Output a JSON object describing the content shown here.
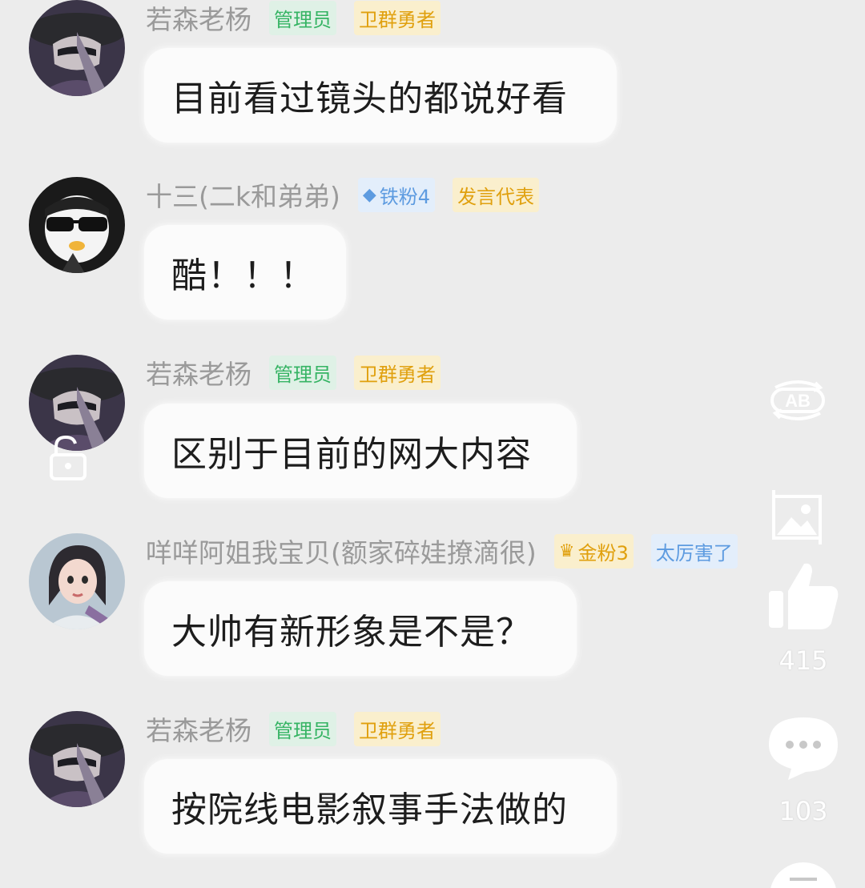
{
  "messages": [
    {
      "name": "若森老杨",
      "badges": [
        {
          "label": "管理员"
        },
        {
          "label": "卫群勇者"
        }
      ],
      "text": "目前看过镜头的都说好看"
    },
    {
      "name": "十三(二k和弟弟)",
      "badges": [
        {
          "label": "铁粉4"
        },
        {
          "label": "发言代表"
        }
      ],
      "text": "酷！！！"
    },
    {
      "name": "若森老杨",
      "badges": [
        {
          "label": "管理员"
        },
        {
          "label": "卫群勇者"
        }
      ],
      "text": "区别于目前的网大内容"
    },
    {
      "name": "咩咩阿姐我宝贝(额家碎娃撩滴很)",
      "badges": [
        {
          "label": "金粉3"
        },
        {
          "label": "太厉害了"
        }
      ],
      "text": "大帅有新形象是不是？"
    },
    {
      "name": "若森老杨",
      "badges": [
        {
          "label": "管理员"
        },
        {
          "label": "卫群勇者"
        }
      ],
      "text": "按院线电影叙事手法做的"
    }
  ],
  "sidebar": {
    "translate_label": "AB",
    "like_count": "415",
    "comment_count": "103"
  },
  "colors": {
    "background": "#ececec",
    "bubble": "#fbfbfb",
    "admin_badge": "#36b464",
    "orange_badge": "#e0a00e",
    "blue_badge": "#5d9be0"
  }
}
